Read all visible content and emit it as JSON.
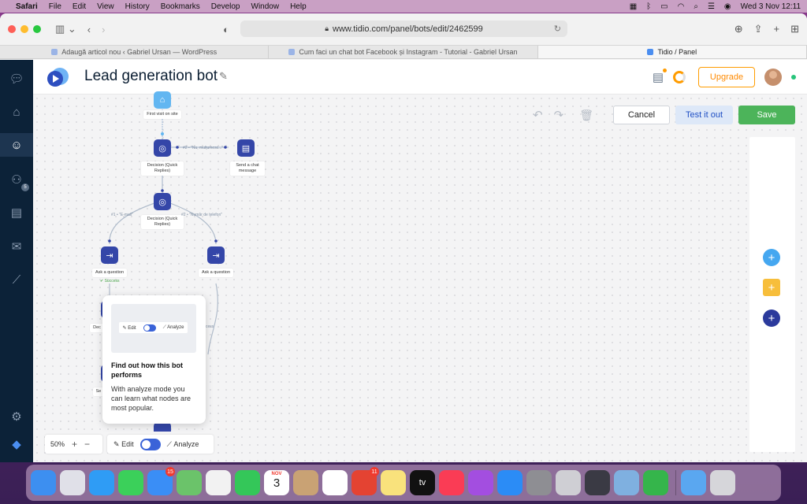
{
  "menubar": {
    "app": "Safari",
    "items": [
      "File",
      "Edit",
      "View",
      "History",
      "Bookmarks",
      "Develop",
      "Window",
      "Help"
    ],
    "datetime": "Wed 3 Nov  12:11"
  },
  "browser": {
    "url": "www.tidio.com/panel/bots/edit/2462599",
    "tabs": [
      {
        "label": "Adaugă articol nou ‹ Gabriel Ursan — WordPress",
        "active": false
      },
      {
        "label": "Cum faci un chat bot Facebook și Instagram - Tutorial - Gabriel Ursan",
        "active": false
      },
      {
        "label": "Tidio / Panel",
        "active": true
      }
    ]
  },
  "header": {
    "title": "Lead generation bot",
    "upgrade_label": "Upgrade"
  },
  "sidebar": {
    "items": [
      "chat-icon",
      "home-icon",
      "bot-icon",
      "contacts-icon",
      "address-book-icon",
      "mail-icon",
      "analytics-icon",
      "settings-icon"
    ],
    "contacts_badge": "5"
  },
  "canvas_actions": {
    "cancel_label": "Cancel",
    "test_label": "Test it out",
    "save_label": "Save"
  },
  "flow": {
    "nodes": [
      {
        "id": "start",
        "label": "First visit on site"
      },
      {
        "id": "decision1",
        "label": "Decision (Quick Replies)"
      },
      {
        "id": "send",
        "label": "Send a chat message"
      },
      {
        "id": "decision2",
        "label": "Decision (Quick Replies)"
      },
      {
        "id": "ask1",
        "label": "Ask a question"
      },
      {
        "id": "ask2",
        "label": "Ask a question"
      }
    ],
    "edges": [
      {
        "label": "#2 • \"Nu, mulțumesc...\""
      },
      {
        "label": "#1 • \"E-mail\""
      },
      {
        "label": "#2 • \"Număr de telefon\""
      }
    ],
    "success_label": "Success",
    "partial_labels": [
      "Dec",
      "Se",
      "cess"
    ]
  },
  "popup": {
    "mini_edit": "Edit",
    "mini_analyze": "Analyze",
    "title": "Find out how this bot performs",
    "text": "With analyze mode you can learn what nodes are most popular."
  },
  "bottom": {
    "zoom": "50%",
    "edit_label": "Edit",
    "analyze_label": "Analyze"
  },
  "dock": {
    "apps": [
      {
        "name": "Finder",
        "color": "#3d8ff0"
      },
      {
        "name": "Launchpad",
        "color": "#e0e0e8"
      },
      {
        "name": "Safari",
        "color": "#2f9cf5"
      },
      {
        "name": "Messages",
        "color": "#3bd05a"
      },
      {
        "name": "Mail",
        "color": "#3a8ef6",
        "badge": "15"
      },
      {
        "name": "Maps",
        "color": "#6bc36a"
      },
      {
        "name": "Photos",
        "color": "#f2f2f2"
      },
      {
        "name": "FaceTime",
        "color": "#34c759"
      },
      {
        "name": "Calendar",
        "color": "#ffffff",
        "text": "3",
        "subtext": "NOV"
      },
      {
        "name": "Contacts",
        "color": "#c9a274"
      },
      {
        "name": "Reminders",
        "color": "#ffffff"
      },
      {
        "name": "Todoist",
        "color": "#e44332",
        "badge": "11"
      },
      {
        "name": "Notes",
        "color": "#f9e27c"
      },
      {
        "name": "TV",
        "color": "#111111",
        "text": "tv"
      },
      {
        "name": "Music",
        "color": "#fa3c55"
      },
      {
        "name": "Podcasts",
        "color": "#a34ee0"
      },
      {
        "name": "App Store",
        "color": "#2b8cf6"
      },
      {
        "name": "System Preferences",
        "color": "#8e8e93"
      },
      {
        "name": "Roblox",
        "color": "#cfcfd4"
      },
      {
        "name": "QuickTime",
        "color": "#3a3a44"
      },
      {
        "name": "Preview",
        "color": "#7fb0e0"
      },
      {
        "name": "Numbers",
        "color": "#35b54b"
      },
      {
        "name": "Downloads",
        "color": "#5aa7f0"
      },
      {
        "name": "Trash",
        "color": "#d6d6da"
      }
    ]
  }
}
